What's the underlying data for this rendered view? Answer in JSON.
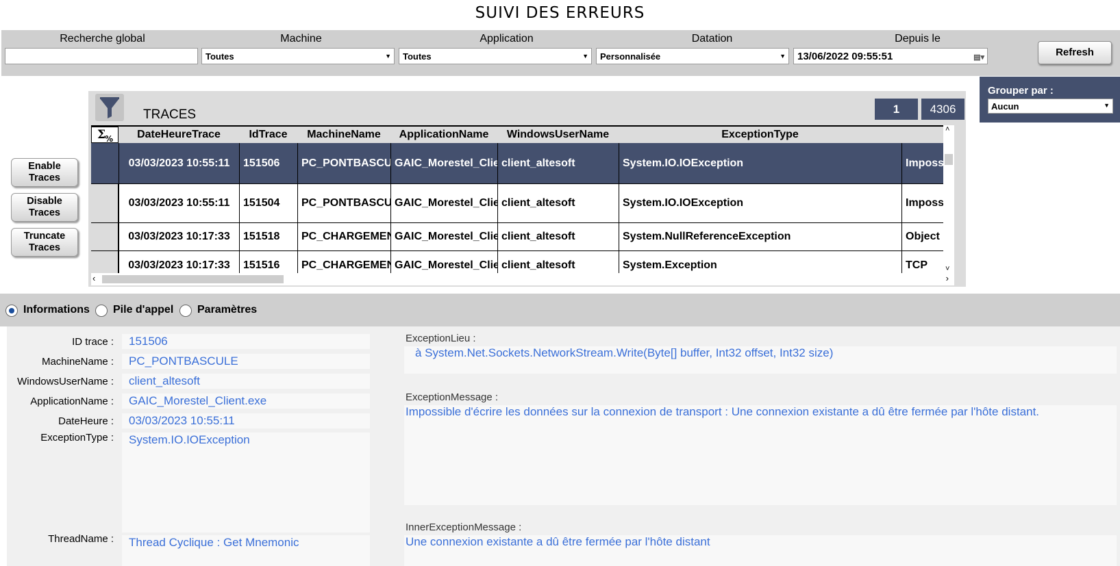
{
  "title": "SUIVI DES ERREURS",
  "filters": {
    "global_label": "Recherche global",
    "global_value": "",
    "machine_label": "Machine",
    "machine_value": "Toutes",
    "application_label": "Application",
    "application_value": "Toutes",
    "datation_label": "Datation",
    "datation_value": "Personnalisée",
    "depuis_label": "Depuis le",
    "depuis_value": "13/06/2022 09:55:51",
    "refresh_label": "Refresh"
  },
  "side_buttons": {
    "enable": "Enable Traces",
    "disable": "Disable Traces",
    "truncate": "Truncate Traces"
  },
  "traces": {
    "title": "TRACES",
    "page": "1",
    "total": "4306",
    "sum_icon": "sum-percent-icon",
    "columns": [
      "DateHeureTrace",
      "IdTrace",
      "MachineName",
      "ApplicationName",
      "WindowsUserName",
      "ExceptionType"
    ],
    "rows": [
      {
        "date": "03/03/2023 10:55:11",
        "id": "151506",
        "machine": "PC_PONTBASCULE",
        "app": "GAIC_Morestel_Client.exe",
        "user": "client_altesoft",
        "exc": "System.IO.IOException",
        "extra": "Impossible"
      },
      {
        "date": "03/03/2023 10:55:11",
        "id": "151504",
        "machine": "PC_PONTBASCULE",
        "app": "GAIC_Morestel_Client.exe",
        "user": "client_altesoft",
        "exc": "System.IO.IOException",
        "extra": "Impossible"
      },
      {
        "date": "03/03/2023 10:17:33",
        "id": "151518",
        "machine": "PC_CHARGEMENT",
        "app": "GAIC_Morestel_Client.exe",
        "user": "client_altesoft",
        "exc": "System.NullReferenceException",
        "extra": "Object"
      },
      {
        "date": "03/03/2023 10:17:33",
        "id": "151516",
        "machine": "PC_CHARGEMENT",
        "app": "GAIC_Morestel_Client.exe",
        "user": "client_altesoft",
        "exc": "System.Exception",
        "extra": "TCP"
      }
    ]
  },
  "group": {
    "label": "Grouper par :",
    "value": "Aucun"
  },
  "tabs": {
    "informations": "Informations",
    "pile": "Pile d'appel",
    "parametres": "Paramètres"
  },
  "details": {
    "id_label": "ID trace :",
    "id_value": "151506",
    "machine_label": "MachineName :",
    "machine_value": "PC_PONTBASCULE",
    "user_label": "WindowsUserName :",
    "user_value": "client_altesoft",
    "app_label": "ApplicationName :",
    "app_value": "GAIC_Morestel_Client.exe",
    "date_label": "DateHeure :",
    "date_value": "03/03/2023 10:55:11",
    "exc_label": "ExceptionType :",
    "exc_value": "System.IO.IOException",
    "thread_label": "ThreadName :",
    "thread_value": "Thread Cyclique : Get Mnemonic",
    "lieu_label": "ExceptionLieu :",
    "lieu_value": "à System.Net.Sockets.NetworkStream.Write(Byte[] buffer, Int32 offset, Int32 size)",
    "message_label": "ExceptionMessage :",
    "message_value": "Impossible d'écrire les données sur la connexion de transport : Une connexion existante a dû être fermée par l'hôte distant.",
    "inner_label": "InnerExceptionMessage :",
    "inner_value": "Une connexion existante a dû être fermée par l'hôte distant"
  }
}
